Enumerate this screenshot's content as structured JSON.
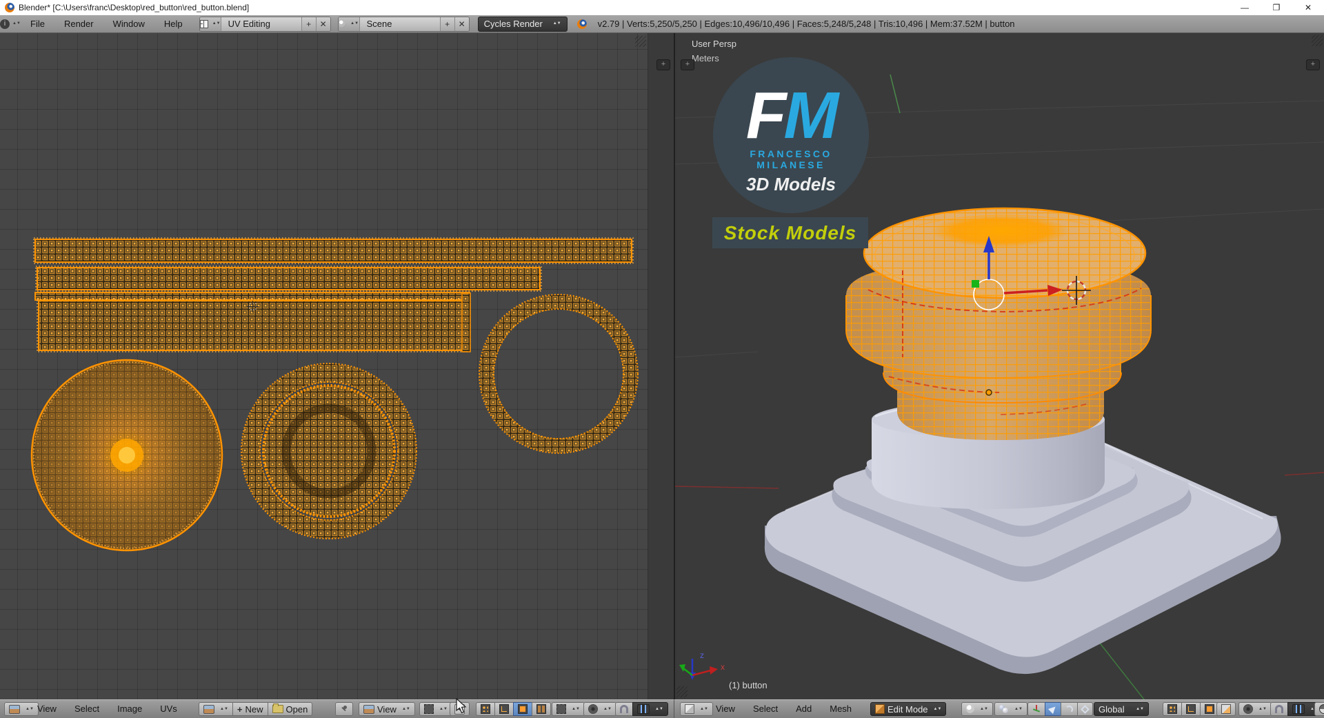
{
  "window": {
    "title": "Blender* [C:\\Users\\franc\\Desktop\\red_button\\red_button.blend]",
    "minimize": "—",
    "maximize": "❐",
    "close": "✕"
  },
  "top_header": {
    "menus": [
      "File",
      "Render",
      "Window",
      "Help"
    ],
    "layout_selector": {
      "value": "UV Editing",
      "add": "+",
      "remove": "✕"
    },
    "scene_selector": {
      "value": "Scene",
      "add": "+",
      "remove": "✕"
    },
    "engine_selector": {
      "value": "Cycles Render"
    },
    "stats": "v2.79 | Verts:5,250/5,250 | Edges:10,496/10,496 | Faces:5,248/5,248 | Tris:10,496 | Mem:37.52M | button"
  },
  "uv_editor": {
    "header": {
      "menus": [
        "View",
        "Select",
        "Image",
        "UVs"
      ],
      "new_button": "New",
      "open_button": "Open",
      "view_dropdown": "View"
    }
  },
  "viewport3d": {
    "overlay": {
      "view_name": "User Persp",
      "unit": "Meters",
      "object_info": "(1) button",
      "axis_x_label": "x",
      "axis_z_label": "z"
    },
    "logo": {
      "letter_f": "F",
      "letter_m": "M",
      "name": "FRANCESCO MILANESE",
      "subtitle": "3D Models",
      "banner": "Stock Models"
    },
    "header": {
      "menus": [
        "View",
        "Select",
        "Add",
        "Mesh"
      ],
      "mode_dropdown": "Edit Mode",
      "orientation_dropdown": "Global"
    }
  },
  "colors": {
    "selection_orange": "#ff9c00",
    "logo_blue": "#2aa9e1",
    "banner_yellow": "#c3cf0a",
    "active_blue": "#5c86bf"
  }
}
